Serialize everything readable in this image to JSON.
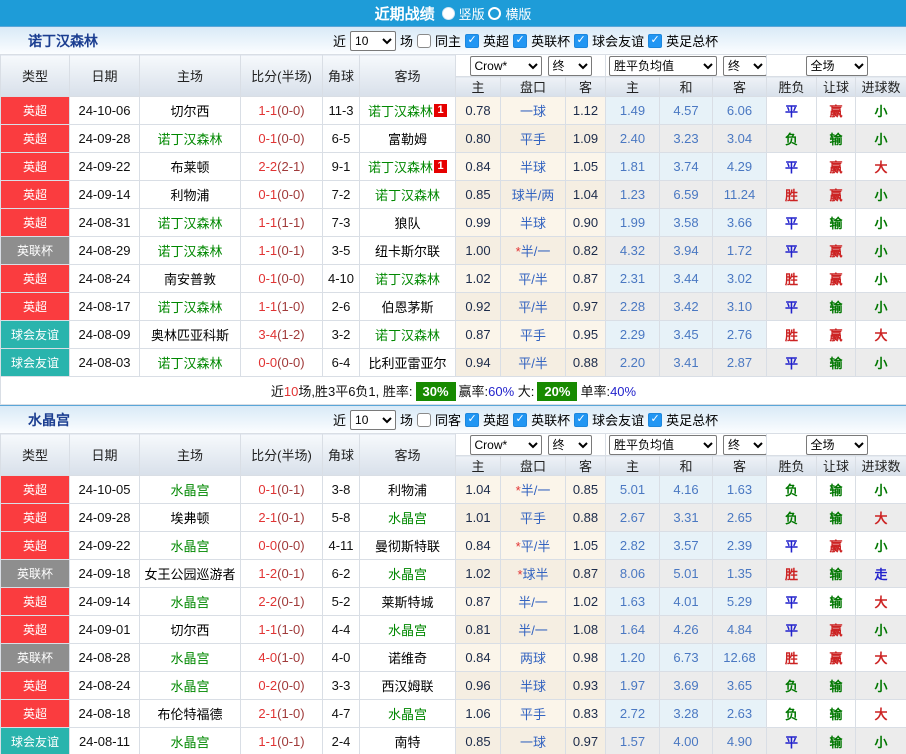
{
  "topbar": {
    "title": "近期战绩",
    "options": [
      {
        "label": "竖版",
        "selected": true
      },
      {
        "label": "横版",
        "selected": false
      }
    ]
  },
  "colors": {
    "topbar_bg": "#1e9cd8",
    "league_premier_red": "#fa3c3f",
    "league_cup_gray": "#8e8e8e",
    "friendly_teal": "#2ab4ad",
    "team_green": "#008800",
    "score_red": "#e23333",
    "win_red": "#cc2222",
    "draw_blue": "#2222cc",
    "lose_green": "#007700",
    "mean_blue": "#4a78c2",
    "handicap_blue": "#3363c0",
    "summary_green_bg": "#178a00",
    "checkbox_blue": "#2196f3",
    "section_title_navy": "#1b3e91"
  },
  "columns": {
    "type": "类型",
    "date": "日期",
    "home": "主场",
    "score": "比分(半场)",
    "corner": "角球",
    "away": "客场",
    "crow_select": "Crow*",
    "crow_final_select": "终",
    "crow_sub": [
      "主",
      "盘口",
      "客"
    ],
    "mean_select": "胜平负均值",
    "mean_final_select": "终",
    "mean_sub": [
      "主",
      "和",
      "客"
    ],
    "scope_select": "全场",
    "result_sub": [
      "胜负",
      "让球",
      "进球数"
    ]
  },
  "sections": [
    {
      "team": "诺丁汉森林",
      "filter": {
        "near_label": "近",
        "games": "10",
        "games_label": "场",
        "same_label": "同主",
        "same_checked": false,
        "leagues": [
          "英超",
          "英联杯",
          "球会友谊",
          "英足总杯"
        ]
      },
      "rows": [
        {
          "league": "英超",
          "date": "24-10-06",
          "home": "切尔西",
          "home_is_team": false,
          "score": "1-1",
          "half": "(0-0)",
          "corners": "11-3",
          "away": "诺丁汉森林",
          "away_is_team": true,
          "away_card": "1",
          "odds": [
            "0.78",
            "一球",
            "1.12"
          ],
          "means": [
            "1.49",
            "4.57",
            "6.06"
          ],
          "results": [
            "平",
            "赢",
            "小"
          ]
        },
        {
          "league": "英超",
          "date": "24-09-28",
          "home": "诺丁汉森林",
          "home_is_team": true,
          "score": "0-1",
          "half": "(0-0)",
          "corners": "6-5",
          "away": "富勒姆",
          "away_is_team": false,
          "away_card": "",
          "odds": [
            "0.80",
            "平手",
            "1.09"
          ],
          "means": [
            "2.40",
            "3.23",
            "3.04"
          ],
          "results": [
            "负",
            "输",
            "小"
          ]
        },
        {
          "league": "英超",
          "date": "24-09-22",
          "home": "布莱顿",
          "home_is_team": false,
          "score": "2-2",
          "half": "(2-1)",
          "corners": "9-1",
          "away": "诺丁汉森林",
          "away_is_team": true,
          "away_card": "1",
          "odds": [
            "0.84",
            "半球",
            "1.05"
          ],
          "means": [
            "1.81",
            "3.74",
            "4.29"
          ],
          "results": [
            "平",
            "赢",
            "大"
          ]
        },
        {
          "league": "英超",
          "date": "24-09-14",
          "home": "利物浦",
          "home_is_team": false,
          "score": "0-1",
          "half": "(0-0)",
          "corners": "7-2",
          "away": "诺丁汉森林",
          "away_is_team": true,
          "away_card": "",
          "odds": [
            "0.85",
            "球半/两",
            "1.04"
          ],
          "means": [
            "1.23",
            "6.59",
            "11.24"
          ],
          "results": [
            "胜",
            "赢",
            "小"
          ]
        },
        {
          "league": "英超",
          "date": "24-08-31",
          "home": "诺丁汉森林",
          "home_is_team": true,
          "score": "1-1",
          "half": "(1-1)",
          "corners": "7-3",
          "away": "狼队",
          "away_is_team": false,
          "away_card": "",
          "odds": [
            "0.99",
            "半球",
            "0.90"
          ],
          "means": [
            "1.99",
            "3.58",
            "3.66"
          ],
          "results": [
            "平",
            "输",
            "小"
          ]
        },
        {
          "league": "英联杯",
          "date": "24-08-29",
          "home": "诺丁汉森林",
          "home_is_team": true,
          "score": "1-1",
          "half": "(0-1)",
          "corners": "3-5",
          "away": "纽卡斯尔联",
          "away_is_team": false,
          "away_card": "",
          "odds": [
            "1.00",
            "*半/一",
            "0.82"
          ],
          "means": [
            "4.32",
            "3.94",
            "1.72"
          ],
          "results": [
            "平",
            "赢",
            "小"
          ]
        },
        {
          "league": "英超",
          "date": "24-08-24",
          "home": "南安普敦",
          "home_is_team": false,
          "score": "0-1",
          "half": "(0-0)",
          "corners": "4-10",
          "away": "诺丁汉森林",
          "away_is_team": true,
          "away_card": "",
          "odds": [
            "1.02",
            "平/半",
            "0.87"
          ],
          "means": [
            "2.31",
            "3.44",
            "3.02"
          ],
          "results": [
            "胜",
            "赢",
            "小"
          ]
        },
        {
          "league": "英超",
          "date": "24-08-17",
          "home": "诺丁汉森林",
          "home_is_team": true,
          "score": "1-1",
          "half": "(1-0)",
          "corners": "2-6",
          "away": "伯恩茅斯",
          "away_is_team": false,
          "away_card": "",
          "odds": [
            "0.92",
            "平/半",
            "0.97"
          ],
          "means": [
            "2.28",
            "3.42",
            "3.10"
          ],
          "results": [
            "平",
            "输",
            "小"
          ]
        },
        {
          "league": "球会友谊",
          "date": "24-08-09",
          "home": "奥林匹亚科斯",
          "home_is_team": false,
          "score": "3-4",
          "half": "(1-2)",
          "corners": "3-2",
          "away": "诺丁汉森林",
          "away_is_team": true,
          "away_card": "",
          "odds": [
            "0.87",
            "平手",
            "0.95"
          ],
          "means": [
            "2.29",
            "3.45",
            "2.76"
          ],
          "results": [
            "胜",
            "赢",
            "大"
          ]
        },
        {
          "league": "球会友谊",
          "date": "24-08-03",
          "home": "诺丁汉森林",
          "home_is_team": true,
          "score": "0-0",
          "half": "(0-0)",
          "corners": "6-4",
          "away": "比利亚雷亚尔",
          "away_is_team": false,
          "away_card": "",
          "odds": [
            "0.94",
            "平/半",
            "0.88"
          ],
          "means": [
            "2.20",
            "3.41",
            "2.87"
          ],
          "results": [
            "平",
            "输",
            "小"
          ]
        }
      ],
      "summary": {
        "prefix": "近",
        "games": "10",
        "middle": "场,胜3平6负1, 胜率:",
        "win_rate": "30%",
        "win_pct_label": "赢率:",
        "win_pct": "60%",
        "big_label": "大:",
        "big_rate": "20%",
        "single_label": "单率:",
        "single_pct": "40%"
      }
    },
    {
      "team": "水晶宫",
      "filter": {
        "near_label": "近",
        "games": "10",
        "games_label": "场",
        "same_label": "同客",
        "same_checked": false,
        "leagues": [
          "英超",
          "英联杯",
          "球会友谊",
          "英足总杯"
        ]
      },
      "rows": [
        {
          "league": "英超",
          "date": "24-10-05",
          "home": "水晶宫",
          "home_is_team": true,
          "score": "0-1",
          "half": "(0-1)",
          "corners": "3-8",
          "away": "利物浦",
          "away_is_team": false,
          "away_card": "",
          "odds": [
            "1.04",
            "*半/一",
            "0.85"
          ],
          "means": [
            "5.01",
            "4.16",
            "1.63"
          ],
          "results": [
            "负",
            "输",
            "小"
          ]
        },
        {
          "league": "英超",
          "date": "24-09-28",
          "home": "埃弗顿",
          "home_is_team": false,
          "score": "2-1",
          "half": "(0-1)",
          "corners": "5-8",
          "away": "水晶宫",
          "away_is_team": true,
          "away_card": "",
          "odds": [
            "1.01",
            "平手",
            "0.88"
          ],
          "means": [
            "2.67",
            "3.31",
            "2.65"
          ],
          "results": [
            "负",
            "输",
            "大"
          ]
        },
        {
          "league": "英超",
          "date": "24-09-22",
          "home": "水晶宫",
          "home_is_team": true,
          "score": "0-0",
          "half": "(0-0)",
          "corners": "4-11",
          "away": "曼彻斯特联",
          "away_is_team": false,
          "away_card": "",
          "odds": [
            "0.84",
            "*平/半",
            "1.05"
          ],
          "means": [
            "2.82",
            "3.57",
            "2.39"
          ],
          "results": [
            "平",
            "赢",
            "小"
          ]
        },
        {
          "league": "英联杯",
          "date": "24-09-18",
          "home": "女王公园巡游者",
          "home_is_team": false,
          "score": "1-2",
          "half": "(0-1)",
          "corners": "6-2",
          "away": "水晶宫",
          "away_is_team": true,
          "away_card": "",
          "odds": [
            "1.02",
            "*球半",
            "0.87"
          ],
          "means": [
            "8.06",
            "5.01",
            "1.35"
          ],
          "results": [
            "胜",
            "输",
            "走"
          ]
        },
        {
          "league": "英超",
          "date": "24-09-14",
          "home": "水晶宫",
          "home_is_team": true,
          "score": "2-2",
          "half": "(0-1)",
          "corners": "5-2",
          "away": "莱斯特城",
          "away_is_team": false,
          "away_card": "",
          "odds": [
            "0.87",
            "半/一",
            "1.02"
          ],
          "means": [
            "1.63",
            "4.01",
            "5.29"
          ],
          "results": [
            "平",
            "输",
            "大"
          ]
        },
        {
          "league": "英超",
          "date": "24-09-01",
          "home": "切尔西",
          "home_is_team": false,
          "score": "1-1",
          "half": "(1-0)",
          "corners": "4-4",
          "away": "水晶宫",
          "away_is_team": true,
          "away_card": "",
          "odds": [
            "0.81",
            "半/一",
            "1.08"
          ],
          "means": [
            "1.64",
            "4.26",
            "4.84"
          ],
          "results": [
            "平",
            "赢",
            "小"
          ]
        },
        {
          "league": "英联杯",
          "date": "24-08-28",
          "home": "水晶宫",
          "home_is_team": true,
          "score": "4-0",
          "half": "(1-0)",
          "corners": "4-0",
          "away": "诺维奇",
          "away_is_team": false,
          "away_card": "",
          "odds": [
            "0.84",
            "两球",
            "0.98"
          ],
          "means": [
            "1.20",
            "6.73",
            "12.68"
          ],
          "results": [
            "胜",
            "赢",
            "大"
          ]
        },
        {
          "league": "英超",
          "date": "24-08-24",
          "home": "水晶宫",
          "home_is_team": true,
          "score": "0-2",
          "half": "(0-0)",
          "corners": "3-3",
          "away": "西汉姆联",
          "away_is_team": false,
          "away_card": "",
          "odds": [
            "0.96",
            "半球",
            "0.93"
          ],
          "means": [
            "1.97",
            "3.69",
            "3.65"
          ],
          "results": [
            "负",
            "输",
            "小"
          ]
        },
        {
          "league": "英超",
          "date": "24-08-18",
          "home": "布伦特福德",
          "home_is_team": false,
          "score": "2-1",
          "half": "(1-0)",
          "corners": "4-7",
          "away": "水晶宫",
          "away_is_team": true,
          "away_card": "",
          "odds": [
            "1.06",
            "平手",
            "0.83"
          ],
          "means": [
            "2.72",
            "3.28",
            "2.63"
          ],
          "results": [
            "负",
            "输",
            "大"
          ]
        },
        {
          "league": "球会友谊",
          "date": "24-08-11",
          "home": "水晶宫",
          "home_is_team": true,
          "score": "1-1",
          "half": "(0-1)",
          "corners": "2-4",
          "away": "南特",
          "away_is_team": false,
          "away_card": "",
          "odds": [
            "0.85",
            "一球",
            "0.97"
          ],
          "means": [
            "1.57",
            "4.00",
            "4.90"
          ],
          "results": [
            "平",
            "输",
            "小"
          ]
        }
      ],
      "summary": null
    }
  ]
}
